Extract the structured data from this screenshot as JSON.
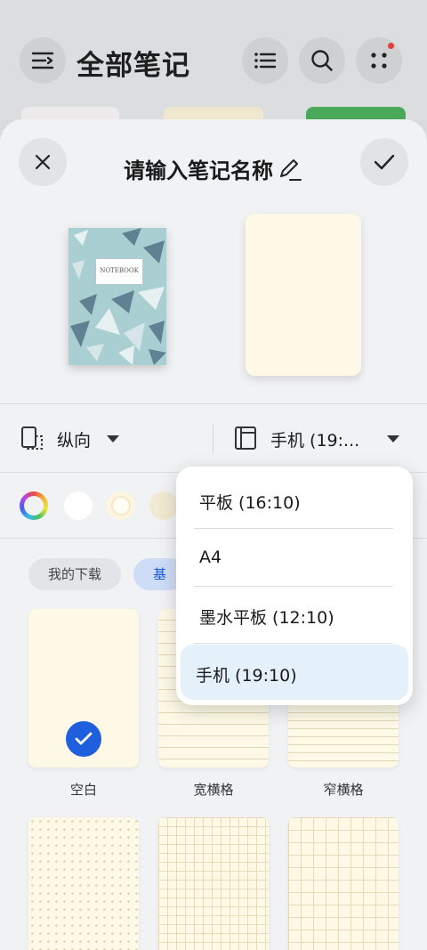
{
  "background": {
    "title": "全部笔记",
    "icons": [
      "menu-icon",
      "list-view-icon",
      "search-icon",
      "more-icon"
    ]
  },
  "sheet": {
    "title": "请输入笔记名称",
    "cover_text": "NOTEBOOK",
    "orientation": "纵向",
    "size": "手机 (19:...",
    "color_icons": [
      "color-wheel",
      "white",
      "paper-white",
      "beige"
    ],
    "tabs": [
      "我的下载",
      "基"
    ],
    "templates": [
      {
        "label": "空白",
        "selected": true
      },
      {
        "label": "宽横格",
        "selected": false
      },
      {
        "label": "窄横格",
        "selected": false
      }
    ]
  },
  "dropdown": {
    "options": [
      "平板 (16:10)",
      "A4",
      "墨水平板 (12:10)",
      "手机 (19:10)"
    ],
    "selected": "手机 (19:10)"
  },
  "colors": {
    "accent": "#1f5fde",
    "paper": "#fdf9e6",
    "selected_bg": "#e4f1fb",
    "notification": "#e0413a"
  }
}
